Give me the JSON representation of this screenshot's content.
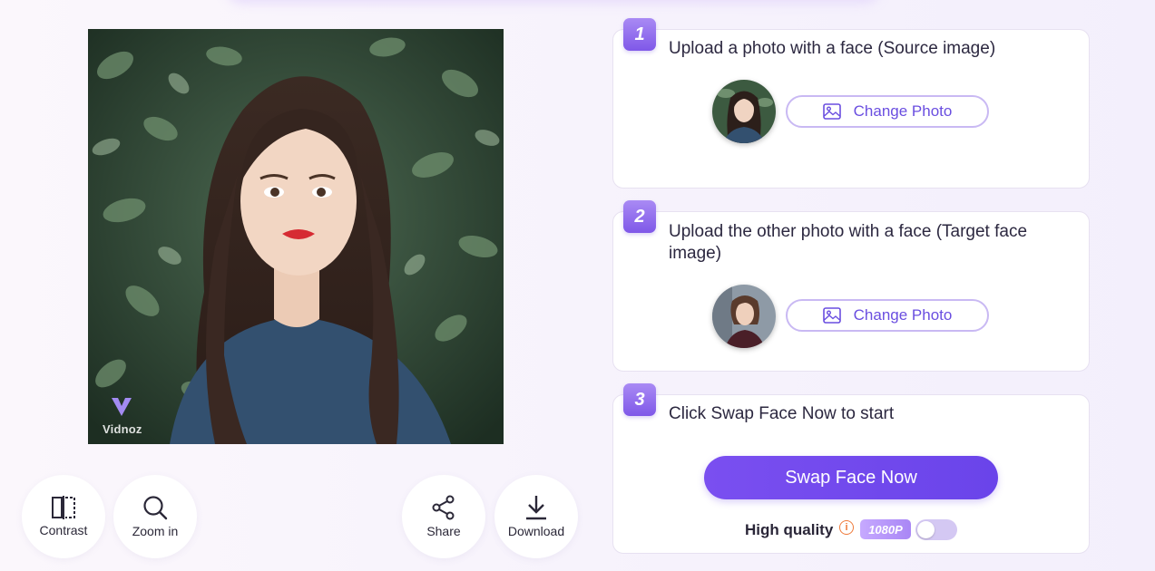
{
  "result": {
    "watermark": "Vidnoz"
  },
  "tools": {
    "contrast": "Contrast",
    "zoom": "Zoom in",
    "share": "Share",
    "download": "Download"
  },
  "steps": [
    {
      "num": "1",
      "title": "Upload a photo with a face (Source image)",
      "button": "Change Photo"
    },
    {
      "num": "2",
      "title": "Upload the other photo with a face (Target face image)",
      "button": "Change Photo"
    },
    {
      "num": "3",
      "title": "Click Swap Face Now to start"
    }
  ],
  "swap": {
    "button": "Swap Face Now",
    "quality_label": "High quality",
    "info_icon": "i",
    "resolution": "1080P",
    "high_quality_enabled": false
  },
  "icons": {
    "contrast": "contrast-compare-icon",
    "zoom": "magnifier-icon",
    "share": "share-nodes-icon",
    "download": "download-arrow-icon",
    "photo": "image-icon"
  },
  "colors": {
    "accent": "#6a44ea",
    "accent_light": "#c9b9f3",
    "info": "#ef7a3a"
  }
}
